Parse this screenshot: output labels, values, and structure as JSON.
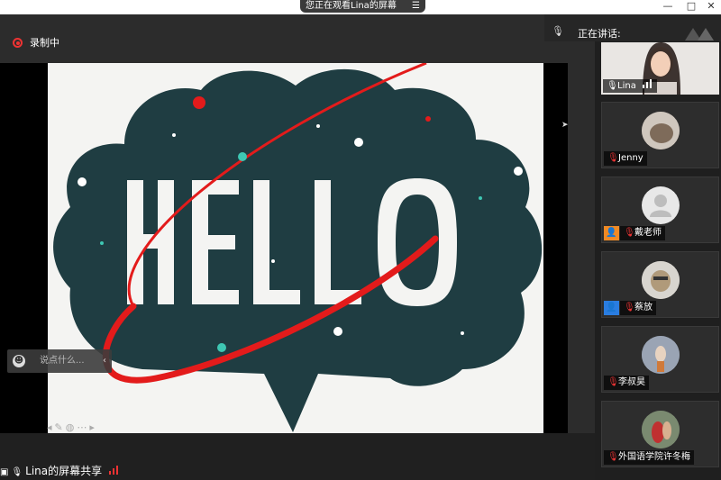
{
  "window": {
    "share_notice": "您正在观看Lina的屏幕",
    "menu_icon": "menu-icon",
    "minimize": "—",
    "maximize": "□",
    "close": "✕"
  },
  "recording": {
    "label": "录制中"
  },
  "slide": {
    "text": "HELLO",
    "bg": "#1f3d42",
    "accent": "#e31b1b",
    "teal": "#3ec7b3"
  },
  "chat": {
    "placeholder": "说点什么...",
    "send_arrow": "‹"
  },
  "toolbar": {
    "icons": [
      "pointer-icon",
      "pen-icon",
      "eraser-icon",
      "more-icon",
      "next-icon"
    ]
  },
  "share_status": {
    "label": "Lina的屏幕共享"
  },
  "sidebar": {
    "speaking_label": "正在讲话:",
    "participants": [
      {
        "name": "Lina",
        "muted": false
      },
      {
        "name": "Jenny",
        "muted": true
      },
      {
        "name": "戴老师",
        "muted": true,
        "role": "orange"
      },
      {
        "name": "蔡放",
        "muted": true,
        "role": "blue"
      },
      {
        "name": "李叔昊",
        "muted": true
      },
      {
        "name": "外国语学院许冬梅",
        "muted": true
      }
    ]
  }
}
